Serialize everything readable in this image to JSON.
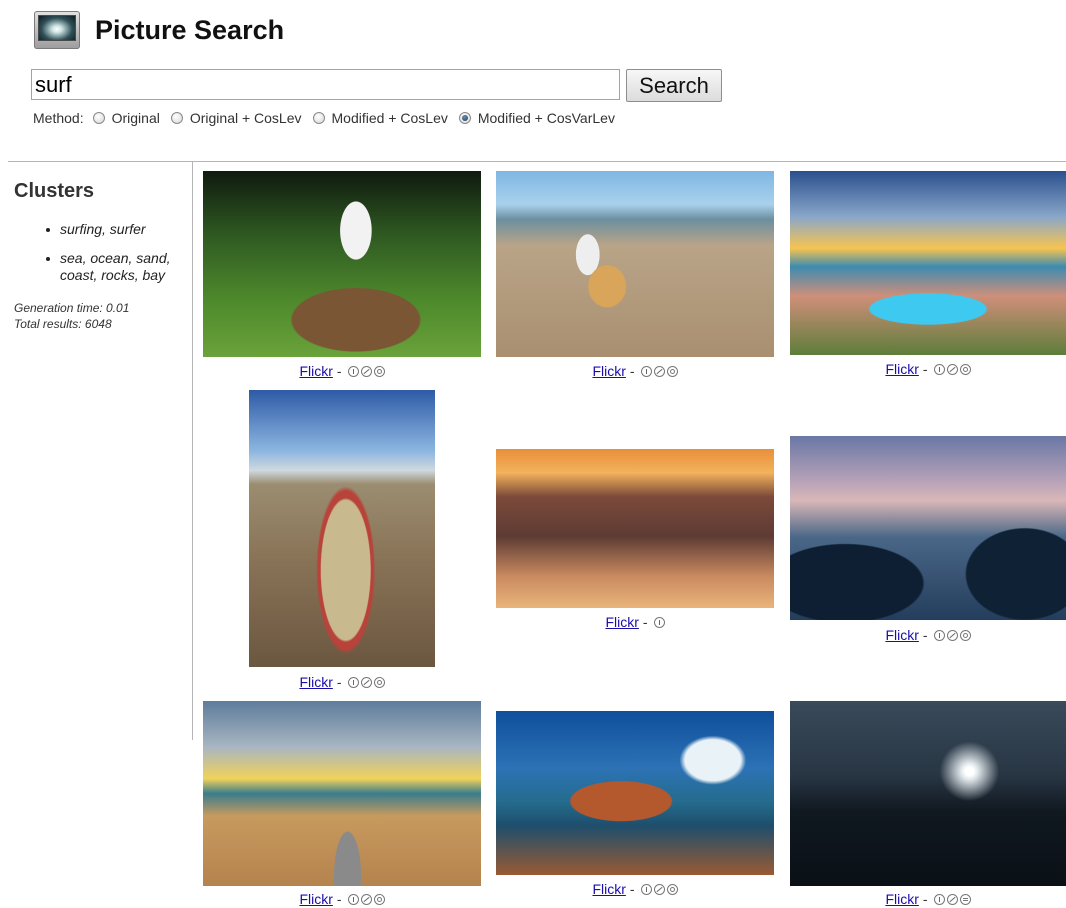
{
  "header": {
    "title": "Picture Search",
    "logo_icon": "picture-frame-icon"
  },
  "search": {
    "query": "surf",
    "button_label": "Search"
  },
  "method": {
    "label": "Method:",
    "options": [
      {
        "label": "Original",
        "selected": false
      },
      {
        "label": "Original + CosLev",
        "selected": false
      },
      {
        "label": "Modified + CosLev",
        "selected": false
      },
      {
        "label": "Modified + CosVarLev",
        "selected": true
      }
    ]
  },
  "sidebar": {
    "title": "Clusters",
    "clusters": [
      "surfing, surfer",
      "sea, ocean, sand, coast, rocks, bay"
    ],
    "generation_time": "Generation time: 0.01",
    "total_results": "Total results: 6048"
  },
  "results": {
    "link_label": "Flickr",
    "separator": "-",
    "items": [
      {
        "scene": "stormtrooper on tortoise",
        "licenses": [
          "by",
          "nc",
          "sa"
        ]
      },
      {
        "scene": "stormtroopers on beach with ring",
        "licenses": [
          "by",
          "nc",
          "sa"
        ]
      },
      {
        "scene": "resort pool at sunset",
        "licenses": [
          "by",
          "nc",
          "sa"
        ]
      },
      {
        "scene": "worn surfboard on sand",
        "licenses": [
          "by",
          "nc",
          "sa"
        ]
      },
      {
        "scene": "jumping in surf at sunset",
        "licenses": [
          "by"
        ]
      },
      {
        "scene": "rocky coast at dusk",
        "licenses": [
          "by",
          "nc",
          "sa"
        ]
      },
      {
        "scene": "beach boardwalk at sunset",
        "licenses": [
          "by",
          "nc",
          "sa"
        ]
      },
      {
        "scene": "waves crashing on rocks",
        "licenses": [
          "by",
          "nc",
          "sa"
        ]
      },
      {
        "scene": "kitesurfer at night",
        "licenses": [
          "by",
          "nc",
          "nd"
        ]
      }
    ]
  },
  "colors": {
    "link": "#1a0dab",
    "divider": "#b5b5b5"
  }
}
